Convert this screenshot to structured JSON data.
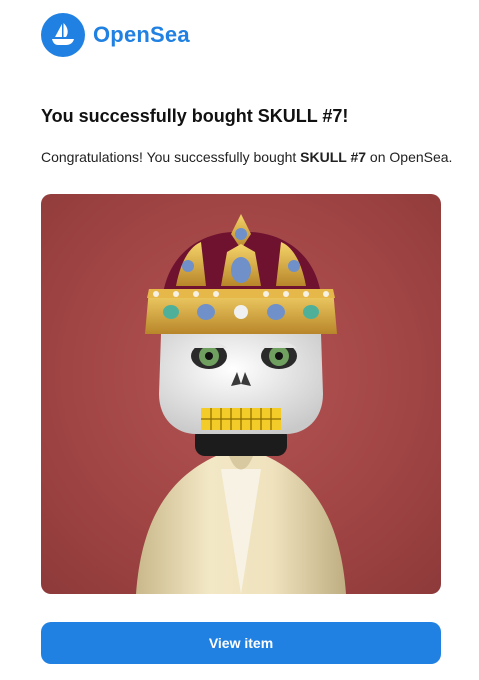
{
  "brand": {
    "name": "OpenSea",
    "color": "#2081E2",
    "logo_icon": "opensea-ship-icon"
  },
  "email": {
    "title": "You successfully bought SKULL #7!",
    "message_prefix": "Congratulations! You successfully bought ",
    "item_name": "SKULL #7",
    "message_suffix": " on OpenSea."
  },
  "nft_image": {
    "subject": "crowned-skull-nft",
    "background_color": "#a84a4a"
  },
  "cta": {
    "label": "View item",
    "color": "#2081E2"
  }
}
